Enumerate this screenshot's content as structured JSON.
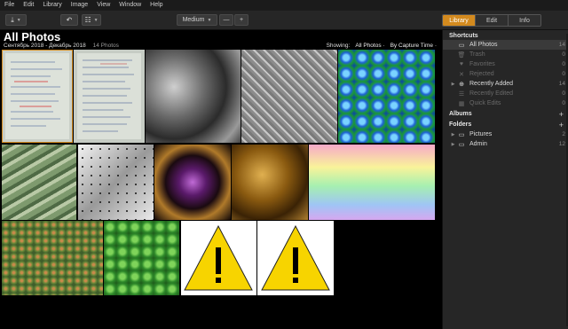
{
  "menu": [
    "File",
    "Edit",
    "Library",
    "Image",
    "View",
    "Window",
    "Help"
  ],
  "toolbar": {
    "import_icon": "download-icon",
    "rotate_icon": "rotate-icon",
    "layout_icon": "grid-layout-icon",
    "zoom_value": "Medium",
    "zoom_out": "—",
    "zoom_in": "+"
  },
  "tabs": [
    {
      "label": "Library",
      "active": true
    },
    {
      "label": "Edit",
      "active": false
    },
    {
      "label": "Info",
      "active": false
    }
  ],
  "header": {
    "title": "All Photos",
    "date_range": "Сентябрь 2018 - Декабрь 2018",
    "count": "14 Photos",
    "showing_label": "Showing:",
    "showing_value": "All Photos",
    "sort_value": "By Capture Time"
  },
  "thumbnails": [
    {
      "name": "handwritten-note-1",
      "selected": true
    },
    {
      "name": "handwritten-note-2",
      "selected": false
    },
    {
      "name": "gray-smoke-texture",
      "selected": false
    },
    {
      "name": "diamond-plate-texture",
      "selected": false
    },
    {
      "name": "blue-spheres-texture",
      "selected": false
    },
    {
      "name": "dollar-bills-texture",
      "selected": false
    },
    {
      "name": "dice-texture",
      "selected": false
    },
    {
      "name": "purple-fractal-texture",
      "selected": false
    },
    {
      "name": "gold-swirl-texture",
      "selected": false
    },
    {
      "name": "pastel-waves-texture",
      "selected": false
    },
    {
      "name": "moss-texture",
      "selected": false
    },
    {
      "name": "clover-texture",
      "selected": false
    },
    {
      "name": "warning-placeholder-1",
      "selected": false
    },
    {
      "name": "warning-placeholder-2",
      "selected": false
    }
  ],
  "sidebar": {
    "shortcuts_heading": "Shortcuts",
    "shortcuts": [
      {
        "label": "All Photos",
        "icon": "photos-icon",
        "count": "14",
        "active": true,
        "dim": false
      },
      {
        "label": "Trash",
        "icon": "trash-icon",
        "count": "0",
        "active": false,
        "dim": true
      },
      {
        "label": "Favorites",
        "icon": "heart-icon",
        "count": "0",
        "active": false,
        "dim": true
      },
      {
        "label": "Rejected",
        "icon": "x-icon",
        "count": "0",
        "active": false,
        "dim": true
      },
      {
        "label": "Recently Added",
        "icon": "plus-circle-icon",
        "count": "14",
        "active": false,
        "dim": false
      },
      {
        "label": "Recently Edited",
        "icon": "sliders-icon",
        "count": "0",
        "active": false,
        "dim": true
      },
      {
        "label": "Quick Edits",
        "icon": "quick-edit-icon",
        "count": "0",
        "active": false,
        "dim": true
      }
    ],
    "albums_heading": "Albums",
    "folders_heading": "Folders",
    "folders": [
      {
        "label": "Pictures",
        "icon": "folder-icon",
        "count": "2"
      },
      {
        "label": "Admin",
        "icon": "folder-icon",
        "count": "12"
      }
    ]
  },
  "colors": {
    "accent": "#d38a1e",
    "sidebar_bg": "#262626",
    "toolbar_bg": "#262626"
  }
}
